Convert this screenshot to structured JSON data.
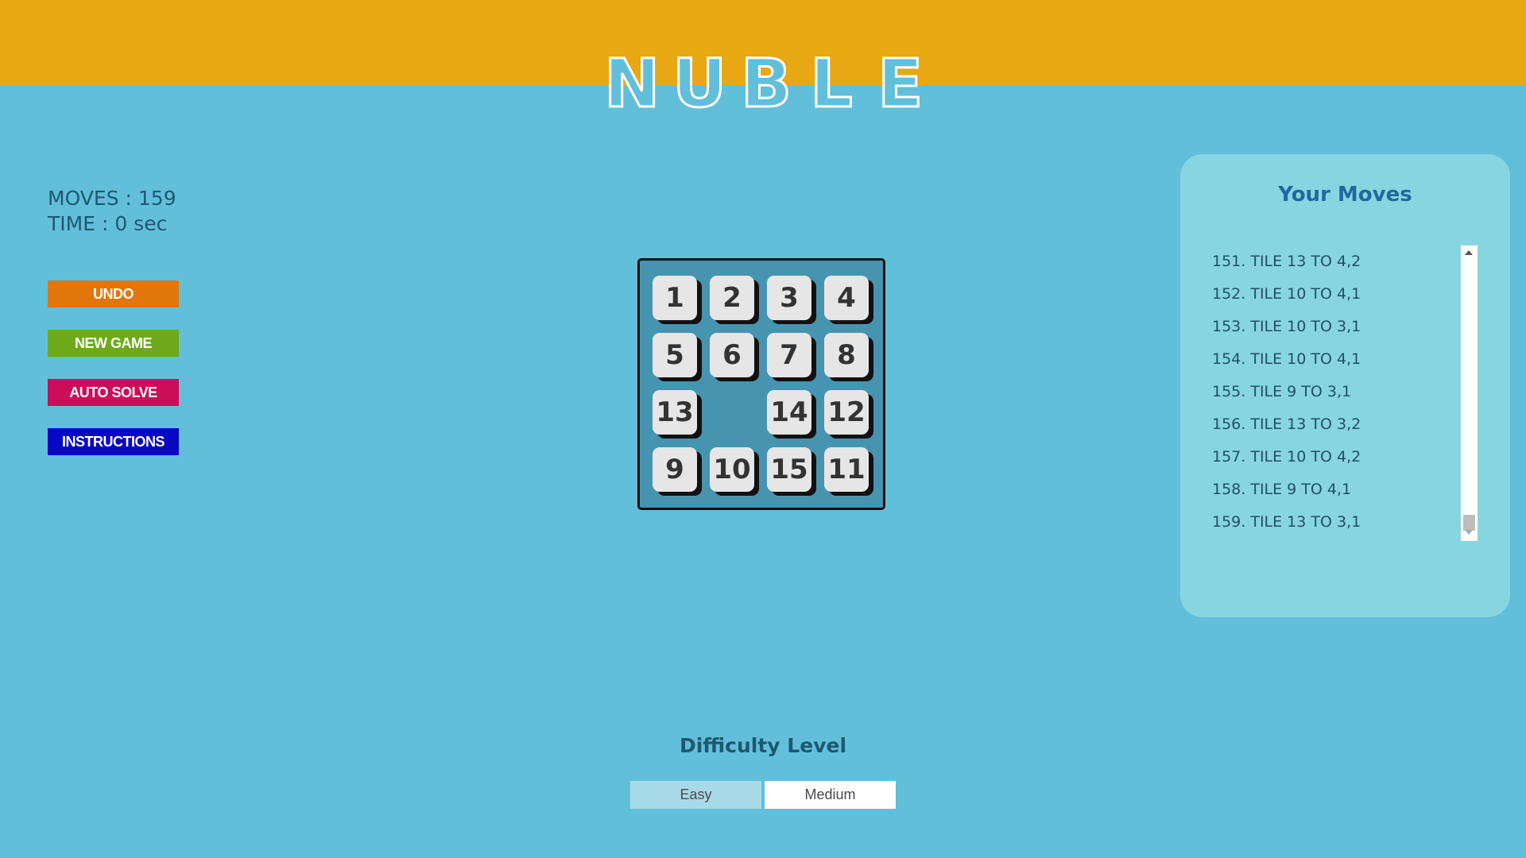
{
  "header": {
    "logo_letters": [
      "N",
      "U",
      "B",
      "L",
      "E"
    ],
    "band_color": "#e8a814"
  },
  "stats": {
    "moves": "MOVES : 159",
    "time": "TIME : 0 sec"
  },
  "controls": {
    "undo": "UNDO",
    "new_game": "NEW GAME",
    "auto_solve": "AUTO SOLVE",
    "instructions": "INSTRUCTIONS"
  },
  "board": {
    "rows": [
      [
        "1",
        "2",
        "3",
        "4"
      ],
      [
        "5",
        "6",
        "7",
        "8"
      ],
      [
        "13",
        "",
        "14",
        "12"
      ],
      [
        "9",
        "10",
        "15",
        "11"
      ]
    ],
    "empty_cell": "3,2"
  },
  "moves_panel": {
    "title": "Your Moves",
    "items": [
      "151. TILE 13 TO 4,2",
      "152. TILE 10 TO 4,1",
      "153. TILE 10 TO 3,1",
      "154. TILE 10 TO 4,1",
      "155. TILE 9 TO 3,1",
      "156. TILE 13 TO 3,2",
      "157. TILE 10 TO 4,2",
      "158. TILE 9 TO 4,1",
      "159. TILE 13 TO 3,1"
    ]
  },
  "difficulty": {
    "title": "Difficulty Level",
    "options": [
      "Easy",
      "Medium"
    ],
    "selected": "Easy"
  },
  "colors": {
    "background": "#62bfda",
    "undo": "#e0760c",
    "new_game": "#6ea91b",
    "auto_solve": "#cc0e5a",
    "instructions": "#0808c4"
  }
}
